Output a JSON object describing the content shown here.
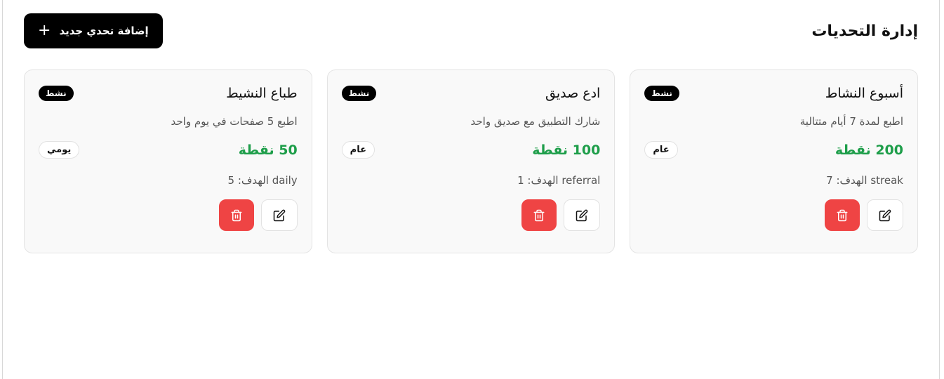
{
  "header": {
    "title": "إدارة التحديات",
    "add_button_label": "إضافة تحدي جديد",
    "add_button_icon": "plus-icon"
  },
  "colors": {
    "points": "#1e9e4a",
    "delete": "#ef4444",
    "primary": "#000000"
  },
  "challenges": [
    {
      "title": "أسبوع النشاط",
      "status": "نشط",
      "description": "اطبع لمدة 7 أيام متتالية",
      "points": "200 نقطة",
      "type": "عام",
      "target": "الهدف: 7 streak"
    },
    {
      "title": "ادع صديق",
      "status": "نشط",
      "description": "شارك التطبيق مع صديق واحد",
      "points": "100 نقطة",
      "type": "عام",
      "target": "الهدف: 1 referral"
    },
    {
      "title": "طباع النشيط",
      "status": "نشط",
      "description": "اطبع 5 صفحات في يوم واحد",
      "points": "50 نقطة",
      "type": "يومي",
      "target": "الهدف: 5 daily"
    }
  ]
}
